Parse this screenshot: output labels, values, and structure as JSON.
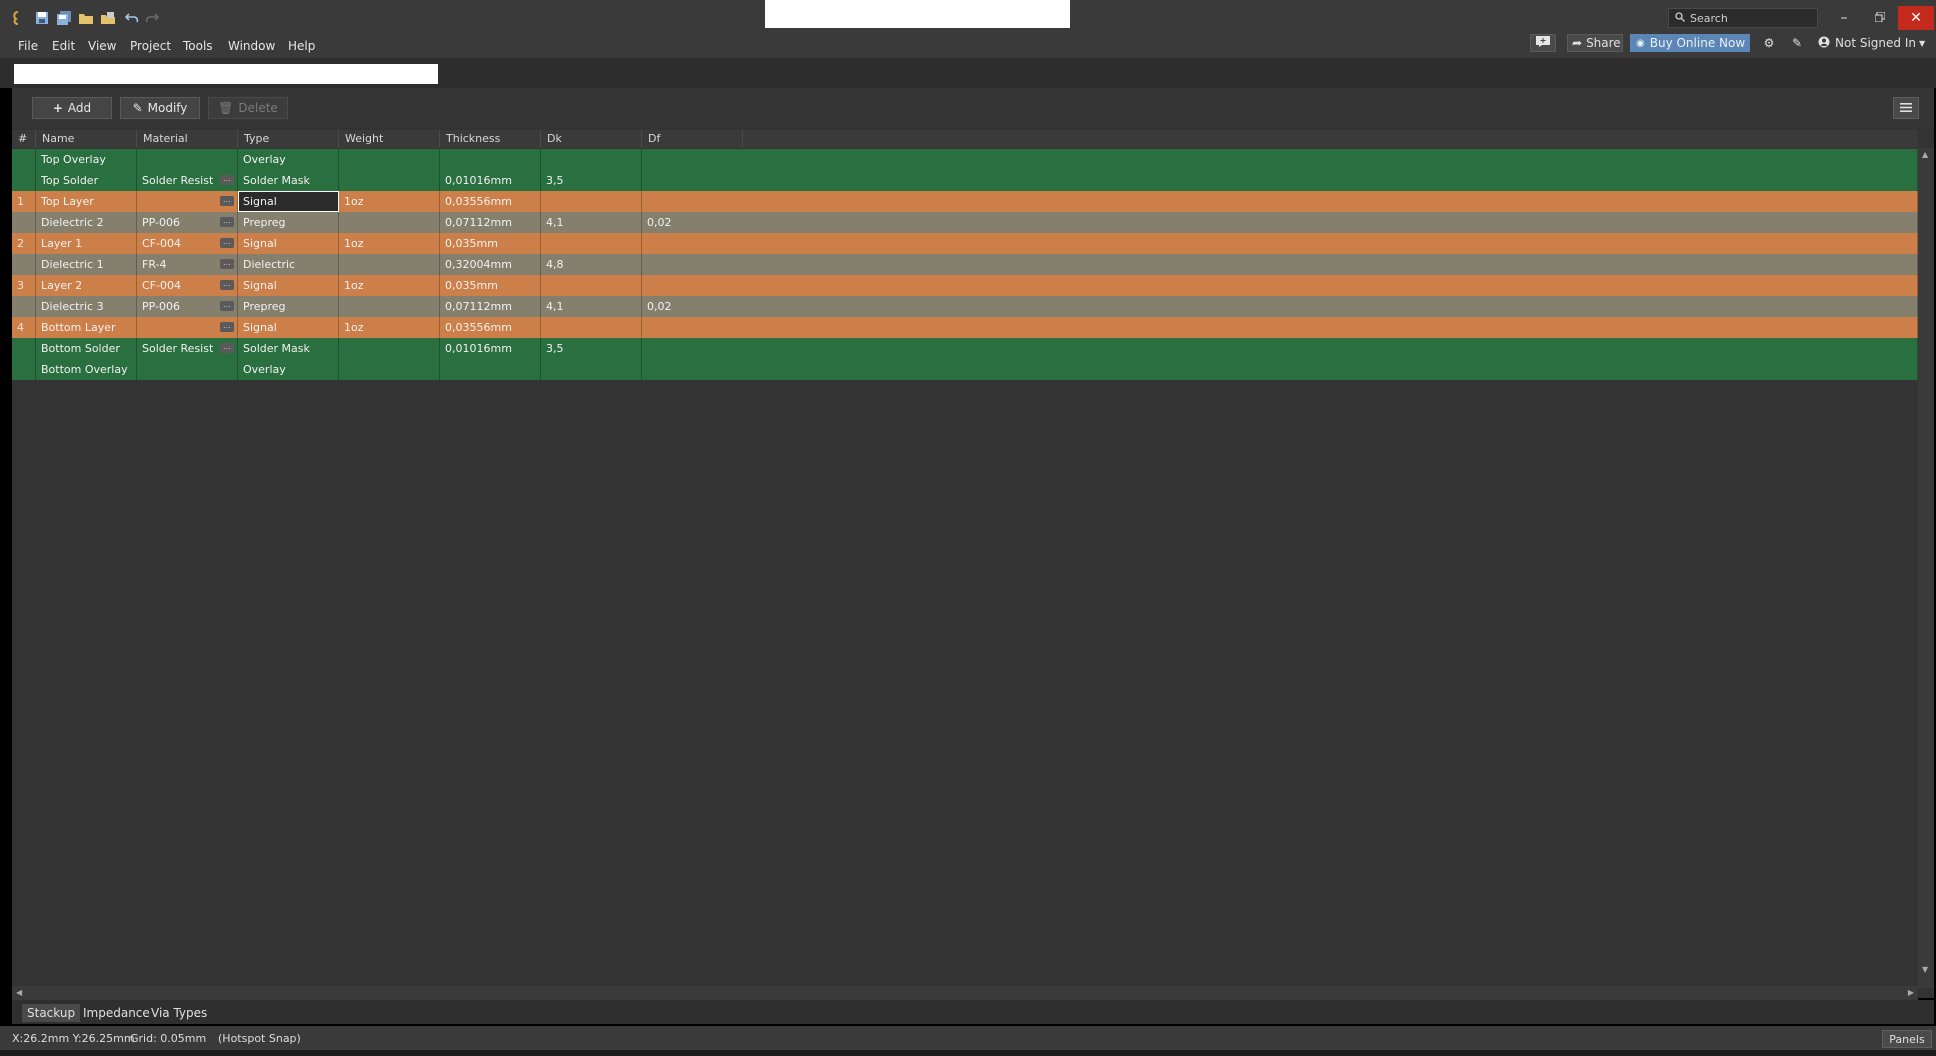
{
  "menu": [
    "File",
    "Edit",
    "View",
    "Project",
    "Tools",
    "Window",
    "Help"
  ],
  "search": {
    "placeholder": "Search"
  },
  "toolbar_right": {
    "share": "Share",
    "buy": "Buy Online Now",
    "account": "Not Signed In"
  },
  "actions": {
    "add": "Add",
    "modify": "Modify",
    "delete": "Delete"
  },
  "columns": [
    "#",
    "Name",
    "Material",
    "Type",
    "Weight",
    "Thickness",
    "Dk",
    "Df"
  ],
  "rows": [
    {
      "num": "",
      "name": "Top Overlay",
      "material": "",
      "type": "Overlay",
      "weight": "",
      "thickness": "",
      "dk": "",
      "df": "",
      "kind": "overlay"
    },
    {
      "num": "",
      "name": "Top Solder",
      "material": "Solder Resist",
      "type": "Solder Mask",
      "weight": "",
      "thickness": "0,01016mm",
      "dk": "3,5",
      "df": "",
      "kind": "mask"
    },
    {
      "num": "1",
      "name": "Top Layer",
      "material": "",
      "type": "Signal",
      "weight": "1oz",
      "thickness": "0,03556mm",
      "dk": "",
      "df": "",
      "kind": "signal-sel"
    },
    {
      "num": "",
      "name": "Dielectric 2",
      "material": "PP-006",
      "type": "Prepreg",
      "weight": "",
      "thickness": "0,07112mm",
      "dk": "4,1",
      "df": "0,02",
      "kind": "dielectric"
    },
    {
      "num": "2",
      "name": "Layer 1",
      "material": "CF-004",
      "type": "Signal",
      "weight": "1oz",
      "thickness": "0,035mm",
      "dk": "",
      "df": "",
      "kind": "signal"
    },
    {
      "num": "",
      "name": "Dielectric 1",
      "material": "FR-4",
      "type": "Dielectric",
      "weight": "",
      "thickness": "0,32004mm",
      "dk": "4,8",
      "df": "",
      "kind": "dielectric"
    },
    {
      "num": "3",
      "name": "Layer 2",
      "material": "CF-004",
      "type": "Signal",
      "weight": "1oz",
      "thickness": "0,035mm",
      "dk": "",
      "df": "",
      "kind": "signal"
    },
    {
      "num": "",
      "name": "Dielectric 3",
      "material": "PP-006",
      "type": "Prepreg",
      "weight": "",
      "thickness": "0,07112mm",
      "dk": "4,1",
      "df": "0,02",
      "kind": "dielectric"
    },
    {
      "num": "4",
      "name": "Bottom Layer",
      "material": "",
      "type": "Signal",
      "weight": "1oz",
      "thickness": "0,03556mm",
      "dk": "",
      "df": "",
      "kind": "signal"
    },
    {
      "num": "",
      "name": "Bottom Solder",
      "material": "Solder Resist",
      "type": "Solder Mask",
      "weight": "",
      "thickness": "0,01016mm",
      "dk": "3,5",
      "df": "",
      "kind": "mask"
    },
    {
      "num": "",
      "name": "Bottom Overlay",
      "material": "",
      "type": "Overlay",
      "weight": "",
      "thickness": "",
      "dk": "",
      "df": "",
      "kind": "overlay"
    }
  ],
  "colors": {
    "green": "#2a6f3f",
    "orange": "#cd7f49",
    "olive": "#85806d",
    "selected_cell": "#2b2b2b"
  },
  "bottom_tabs": [
    "Stackup",
    "Impedance",
    "Via Types"
  ],
  "status": {
    "coords": "X:26.2mm Y:26.25mm",
    "grid": "Grid: 0.05mm",
    "snap": "(Hotspot Snap)",
    "panels": "Panels"
  }
}
